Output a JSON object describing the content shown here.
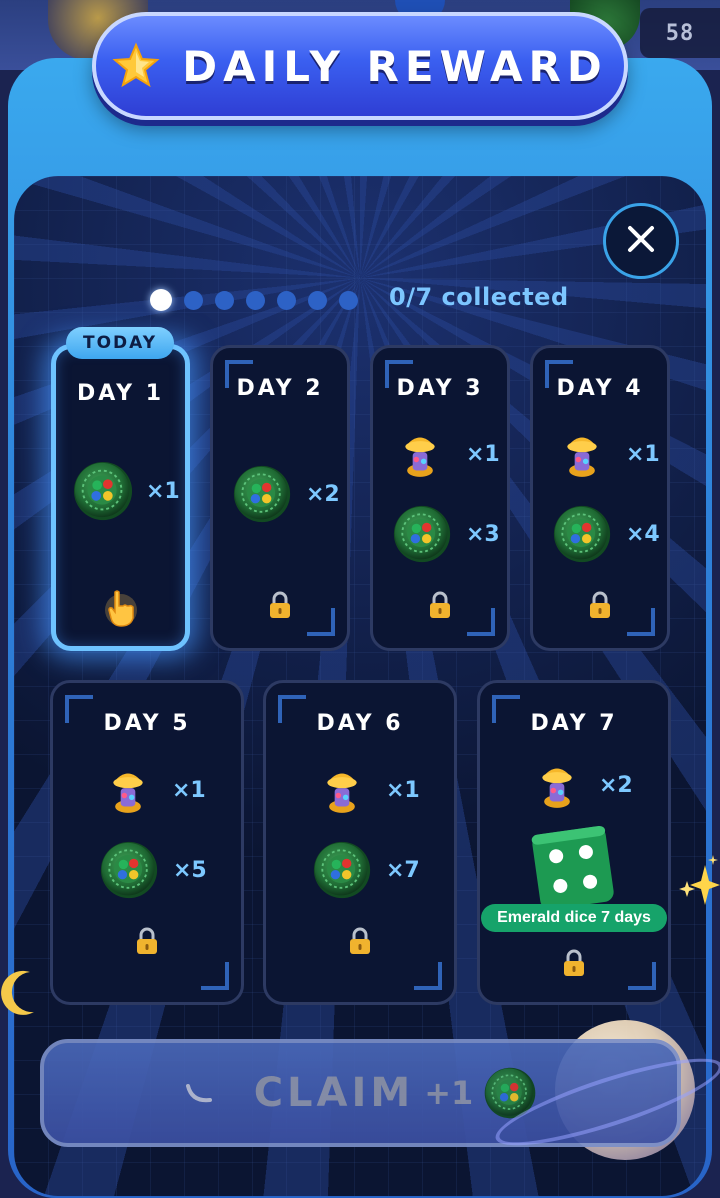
{
  "header": {
    "currency_count": "58",
    "title": "DAILY REWARD",
    "star_icon": "star-icon",
    "close_icon": "close-icon"
  },
  "progress": {
    "total_days": 7,
    "collected": 0,
    "text": "0/7 collected"
  },
  "days": [
    {
      "label": "DAY 1",
      "today_badge": "TODAY",
      "status": "today",
      "rewards": [
        {
          "item": "emerald-coin",
          "qty": "×1"
        }
      ]
    },
    {
      "label": "DAY 2",
      "status": "locked",
      "rewards": [
        {
          "item": "emerald-coin",
          "qty": "×2"
        }
      ]
    },
    {
      "label": "DAY 3",
      "status": "locked",
      "rewards": [
        {
          "item": "golden-token",
          "qty": "×1"
        },
        {
          "item": "emerald-coin",
          "qty": "×3"
        }
      ]
    },
    {
      "label": "DAY 4",
      "status": "locked",
      "rewards": [
        {
          "item": "golden-token",
          "qty": "×1"
        },
        {
          "item": "emerald-coin",
          "qty": "×4"
        }
      ]
    },
    {
      "label": "DAY 5",
      "status": "locked",
      "rewards": [
        {
          "item": "golden-token",
          "qty": "×1"
        },
        {
          "item": "emerald-coin",
          "qty": "×5"
        }
      ]
    },
    {
      "label": "DAY 6",
      "status": "locked",
      "rewards": [
        {
          "item": "golden-token",
          "qty": "×1"
        },
        {
          "item": "emerald-coin",
          "qty": "×7"
        }
      ]
    },
    {
      "label": "DAY 7",
      "status": "locked",
      "rewards": [
        {
          "item": "golden-token",
          "qty": "×2"
        },
        {
          "item": "emerald-dice",
          "tag": "Emerald dice 7 days"
        }
      ]
    }
  ],
  "claim": {
    "label": "CLAIM",
    "amount": "+1",
    "reward_icon": "emerald-coin-icon"
  },
  "colors": {
    "accent_blue": "#3aa9ee",
    "qty_text": "#7dc8ff",
    "emerald_tag": "#16a36a",
    "card_bg": "#0b1533"
  }
}
